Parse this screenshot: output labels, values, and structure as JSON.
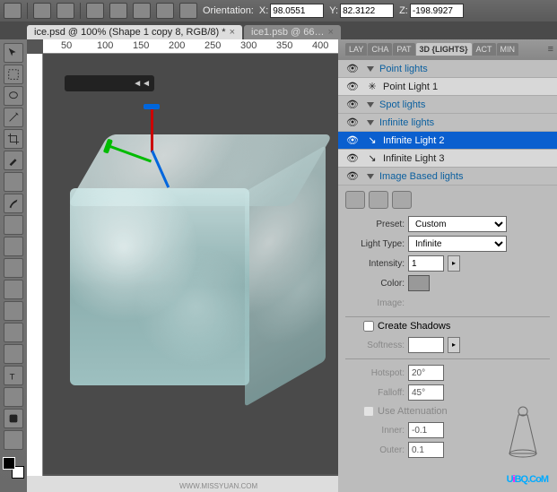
{
  "toolbar": {
    "orientation_label": "Orientation:",
    "x_label": "X:",
    "x_value": "98.0551",
    "y_label": "Y:",
    "y_value": "82.3122",
    "z_label": "Z:",
    "z_value": "-198.9927"
  },
  "tabs": [
    {
      "label": "ice.psd @ 100% (Shape 1 copy 8, RGB/8) *",
      "active": true,
      "close": "×"
    },
    {
      "label": "ice1.psb @ 66…",
      "active": false,
      "close": "×"
    }
  ],
  "nav_float": {
    "arrows": "◄◄"
  },
  "ruler_marks": [
    "50",
    "100",
    "150",
    "200",
    "250",
    "300",
    "350",
    "400"
  ],
  "panel_tabs": [
    "LAY",
    "CHA",
    "PAT",
    "3D {LIGHTS}",
    "ACT",
    "MIN"
  ],
  "panel_active_index": 3,
  "lights": {
    "groups": [
      {
        "name": "Point lights",
        "eye": true,
        "items": [
          {
            "name": "Point Light 1",
            "eye": true,
            "selected": false
          }
        ]
      },
      {
        "name": "Spot lights",
        "eye": true,
        "items": []
      },
      {
        "name": "Infinite lights",
        "eye": true,
        "items": [
          {
            "name": "Infinite Light 2",
            "eye": true,
            "selected": true
          },
          {
            "name": "Infinite Light 3",
            "eye": true,
            "selected": false
          }
        ]
      },
      {
        "name": "Image Based lights",
        "eye": true,
        "items": []
      }
    ]
  },
  "props": {
    "preset_label": "Preset:",
    "preset_value": "Custom",
    "light_type_label": "Light Type:",
    "light_type_value": "Infinite",
    "intensity_label": "Intensity:",
    "intensity_value": "1",
    "color_label": "Color:",
    "color_value": "#999999",
    "image_label": "Image:",
    "create_shadows_label": "Create Shadows",
    "create_shadows": false,
    "softness_label": "Softness:",
    "softness_value": "",
    "hotspot_label": "Hotspot:",
    "hotspot_value": "20°",
    "falloff_label": "Falloff:",
    "falloff_value": "45°",
    "use_attenuation_label": "Use Attenuation",
    "use_attenuation": false,
    "inner_label": "Inner:",
    "inner_value": "-0.1",
    "outer_label": "Outer:",
    "outer_value": "0.1"
  },
  "watermark": {
    "part1": "U",
    "part2": "i",
    "part3": "BQ.CoM"
  },
  "wm2": "WWW.MISSYUAN.COM"
}
